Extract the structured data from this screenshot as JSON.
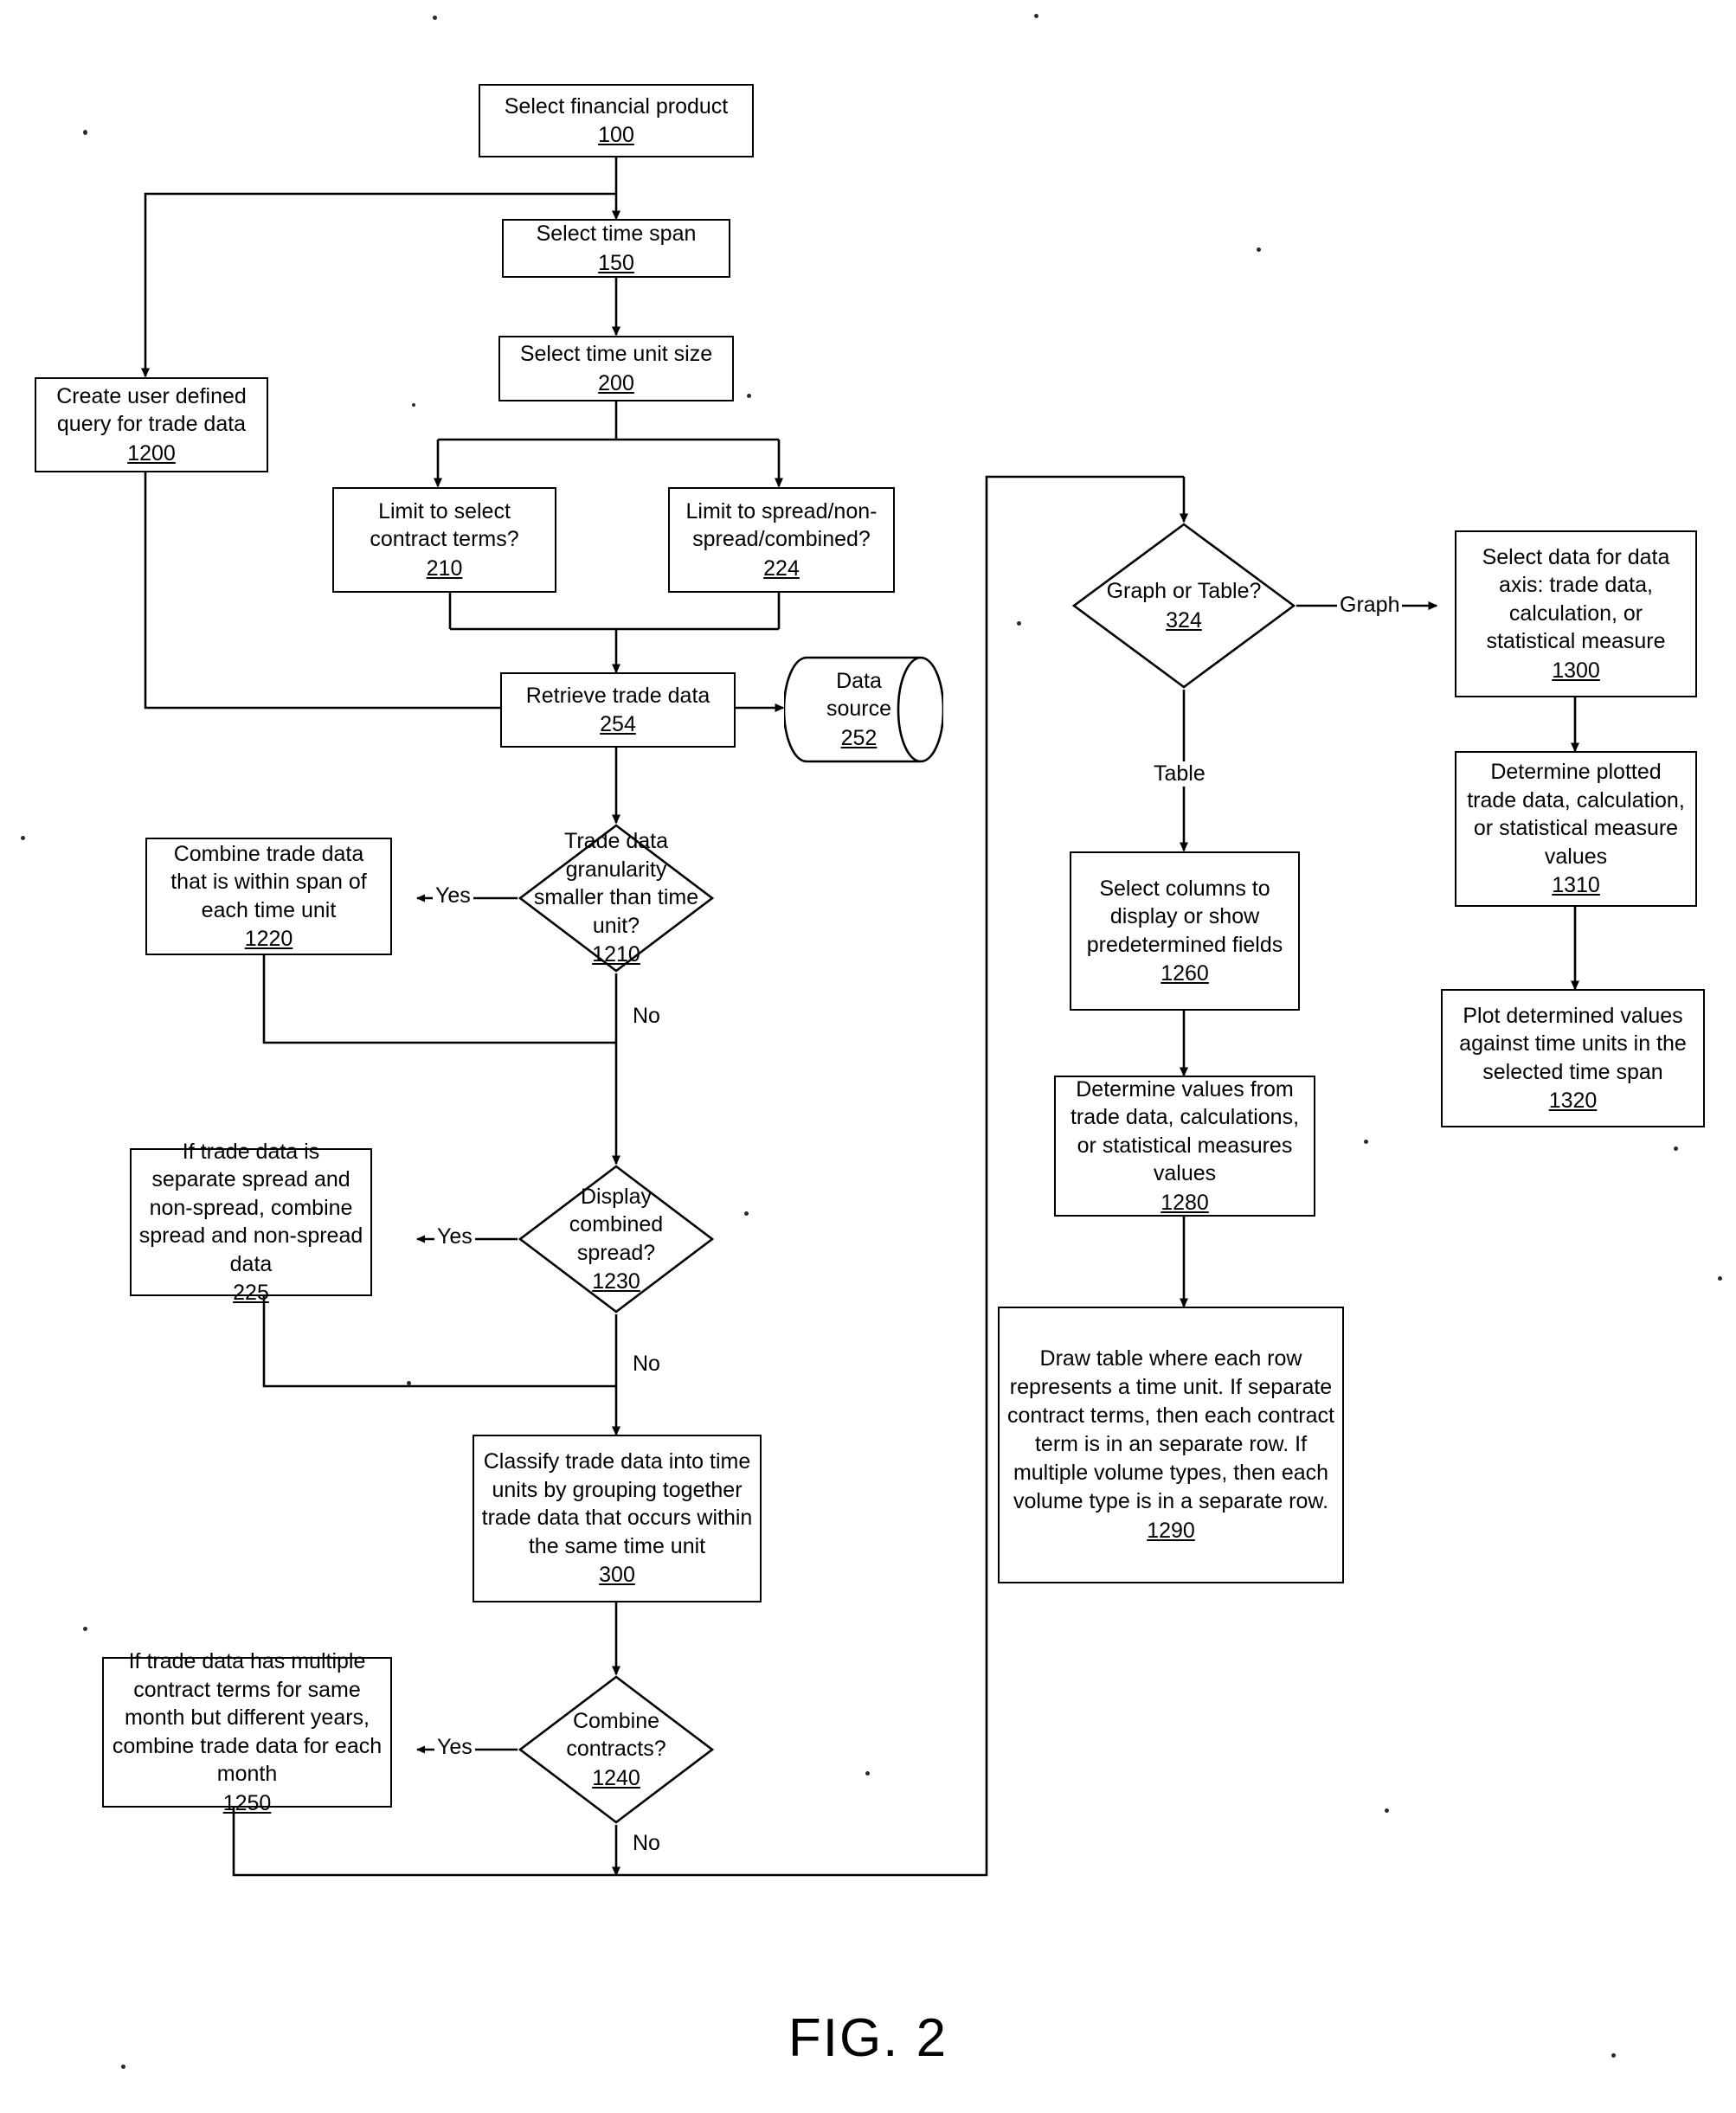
{
  "figure": {
    "caption": "FIG. 2",
    "type": "flowchart"
  },
  "nodes": {
    "n100": {
      "text": "Select financial product",
      "ref": "100",
      "shape": "process"
    },
    "n150": {
      "text": "Select time span",
      "ref": "150",
      "shape": "process"
    },
    "n200": {
      "text": "Select time unit size",
      "ref": "200",
      "shape": "process"
    },
    "n1200": {
      "text": "Create user defined query for trade data",
      "ref": "1200",
      "shape": "process"
    },
    "n210": {
      "text": "Limit to select contract terms?",
      "ref": "210",
      "shape": "process"
    },
    "n224": {
      "text": "Limit to spread/non-spread/combined?",
      "ref": "224",
      "shape": "process"
    },
    "n254": {
      "text": "Retrieve trade data",
      "ref": "254",
      "shape": "process"
    },
    "n252": {
      "text": "Data source",
      "ref": "252",
      "shape": "cylinder"
    },
    "n1210": {
      "text": "Trade data granularity smaller than time unit?",
      "ref": "1210",
      "shape": "decision"
    },
    "n1220": {
      "text": "Combine trade data that is within span of each time unit",
      "ref": "1220",
      "shape": "process"
    },
    "n1230": {
      "text": "Display combined spread?",
      "ref": "1230",
      "shape": "decision"
    },
    "n225": {
      "text": "If trade data is separate spread and non-spread, combine spread and non-spread data",
      "ref": "225",
      "shape": "process"
    },
    "n300": {
      "text": "Classify trade data into time units by grouping together trade data that occurs within the same time unit",
      "ref": "300",
      "shape": "process"
    },
    "n1240": {
      "text": "Combine contracts?",
      "ref": "1240",
      "shape": "decision"
    },
    "n1250": {
      "text": "If trade data has multiple contract terms for same month but different years, combine trade data for each month",
      "ref": "1250",
      "shape": "process"
    },
    "n324": {
      "text": "Graph or Table?",
      "ref": "324",
      "shape": "decision"
    },
    "n1260": {
      "text": "Select columns to display or show predetermined fields",
      "ref": "1260",
      "shape": "process"
    },
    "n1280": {
      "text": "Determine values from trade data, calculations, or statistical measures values",
      "ref": "1280",
      "shape": "process"
    },
    "n1290": {
      "text": "Draw table where each row represents a time unit.  If separate contract terms, then each contract term is in an separate row.  If multiple volume types, then each volume type is in a separate row.",
      "ref": "1290",
      "shape": "process"
    },
    "n1300": {
      "text": "Select data for data axis: trade data, calculation, or statistical measure",
      "ref": "1300",
      "shape": "process"
    },
    "n1310": {
      "text": "Determine plotted trade data, calculation, or statistical measure values",
      "ref": "1310",
      "shape": "process"
    },
    "n1320": {
      "text": "Plot determined values against time units in the selected time span",
      "ref": "1320",
      "shape": "process"
    }
  },
  "edge_labels": {
    "yes_1210": "Yes",
    "no_1210": "No",
    "yes_1230": "Yes",
    "no_1230": "No",
    "yes_1240": "Yes",
    "no_1240": "No",
    "graph_324": "Graph",
    "table_324": "Table"
  },
  "colors": {
    "stroke": "#000000",
    "background": "#ffffff",
    "text": "#000000"
  }
}
